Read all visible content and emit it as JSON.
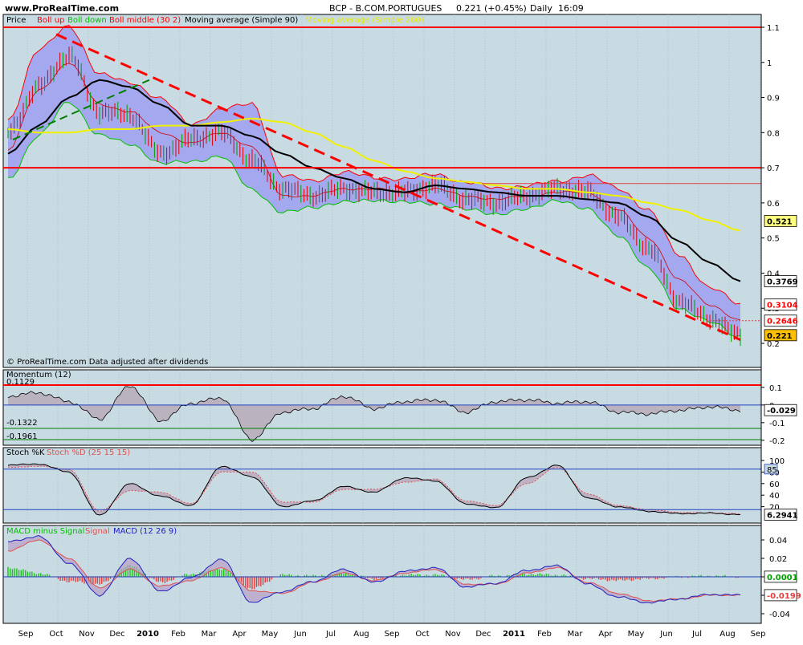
{
  "site": "www.ProRealTime.com",
  "header": {
    "ticker": "BCP - B.COM.PORTUGUES",
    "price": "0.221 (+0.45%)",
    "timeframe": "Daily",
    "time": "16:09"
  },
  "footer_note": "© ProRealTime.com  Data adjusted after dividends",
  "colors": {
    "panel_bg": "#c8dae2",
    "grid": "#9fb7c4",
    "boll_up": "#ff0000",
    "boll_down": "#00c000",
    "boll_middle": "#d00000",
    "band_fill": "#a3a8ef",
    "ma90": "#000000",
    "ma200": "#f0f000",
    "hline_red": "#ff0000",
    "candle_up": "#00a000",
    "candle_down": "#e00000"
  },
  "panels": {
    "price": {
      "legend": [
        {
          "text": "Price",
          "color": "#000000"
        },
        {
          "text": "Boll up",
          "color": "#ff0000"
        },
        {
          "text": "Boll down",
          "color": "#00c000"
        },
        {
          "text": "Boll middle (30 2)",
          "color": "#ff0000"
        },
        {
          "text": "Moving average (Simple 90)",
          "color": "#000000"
        },
        {
          "text": "Moving average (Simple 200)",
          "color": "#e8e800"
        }
      ],
      "ticks": [
        "1.1",
        "1",
        "0.9",
        "0.8",
        "0.7",
        "0.6",
        "0.5",
        "0.4",
        "0.3",
        "0.2"
      ],
      "tags": [
        {
          "text": "0.521",
          "bg": "#ffff80",
          "fg": "#000000"
        },
        {
          "text": "0.3769",
          "bg": "#ffffff",
          "fg": "#000000"
        },
        {
          "text": "0.3104",
          "bg": "#ffffff",
          "fg": "#ff0000"
        },
        {
          "text": "0.2646",
          "bg": "#ffffff",
          "fg": "#ff0000"
        },
        {
          "text": "0.221",
          "bg": "#ffc000",
          "fg": "#000000"
        }
      ]
    },
    "momentum": {
      "legend": "Momentum (12)",
      "labels": [
        "0.1129",
        "-0.1322",
        "-0.1961"
      ],
      "ticks": [
        "0.1",
        "0",
        "-0.1",
        "-0.2"
      ],
      "tag": "-0.029"
    },
    "stoch": {
      "legend_k": "Stoch %K",
      "legend_d": "Stoch %D (25 15 15)",
      "ticks": [
        "100",
        "80",
        "60",
        "40",
        "20"
      ],
      "tag_upper": "85",
      "tag_value": "6.2941"
    },
    "macd": {
      "legend_hist": "MACD minus Signal",
      "legend_signal": "Signal",
      "legend_macd": "MACD (12 26 9)",
      "ticks": [
        "0.04",
        "0.02",
        "0",
        "-0.02",
        "-0.04"
      ],
      "tag_hist": "0.0001",
      "tag_macd": "-0.0199"
    }
  },
  "xaxis": [
    "Sep",
    "Oct",
    "Nov",
    "Dec",
    "2010",
    "Feb",
    "Mar",
    "Apr",
    "May",
    "Jun",
    "Jul",
    "Aug",
    "Sep",
    "Oct",
    "Nov",
    "Dec",
    "2011",
    "Feb",
    "Mar",
    "Apr",
    "May",
    "Jun",
    "Jul",
    "Aug",
    "Sep"
  ],
  "chart_data": [
    {
      "type": "line",
      "title": "BCP - B.COM.PORTUGUES",
      "x": [
        "Sep",
        "Oct",
        "Nov",
        "Dec",
        "2010",
        "Feb",
        "Mar",
        "Apr",
        "May",
        "Jun",
        "Jul",
        "Aug",
        "Sep",
        "Oct",
        "Nov",
        "Dec",
        "2011",
        "Feb",
        "Mar",
        "Apr",
        "May",
        "Jun",
        "Jul",
        "Aug",
        "Sep"
      ],
      "ylim": [
        0.19,
        1.12
      ],
      "grid": false,
      "series": [
        {
          "name": "Price",
          "values": [
            0.8,
            0.93,
            1.02,
            0.86,
            0.85,
            0.74,
            0.78,
            0.8,
            0.72,
            0.64,
            0.62,
            0.64,
            0.63,
            0.63,
            0.65,
            0.61,
            0.6,
            0.62,
            0.64,
            0.63,
            0.56,
            0.47,
            0.32,
            0.27,
            0.221
          ]
        },
        {
          "name": "Boll up",
          "values": [
            0.83,
            1.04,
            1.1,
            0.97,
            0.94,
            0.9,
            0.82,
            0.87,
            0.88,
            0.68,
            0.66,
            0.69,
            0.67,
            0.67,
            0.68,
            0.66,
            0.64,
            0.65,
            0.66,
            0.68,
            0.64,
            0.58,
            0.45,
            0.36,
            0.31
          ]
        },
        {
          "name": "Boll down",
          "values": [
            0.67,
            0.79,
            0.89,
            0.79,
            0.77,
            0.71,
            0.72,
            0.73,
            0.64,
            0.57,
            0.59,
            0.6,
            0.61,
            0.6,
            0.6,
            0.58,
            0.57,
            0.58,
            0.61,
            0.58,
            0.51,
            0.41,
            0.3,
            0.26,
            0.22
          ]
        },
        {
          "name": "Boll middle",
          "values": [
            0.75,
            0.92,
            1.0,
            0.88,
            0.86,
            0.8,
            0.77,
            0.8,
            0.76,
            0.62,
            0.62,
            0.64,
            0.64,
            0.63,
            0.64,
            0.62,
            0.61,
            0.62,
            0.63,
            0.63,
            0.58,
            0.5,
            0.38,
            0.31,
            0.2646
          ]
        },
        {
          "name": "Moving average (Simple 90)",
          "values": [
            0.74,
            0.82,
            0.9,
            0.95,
            0.93,
            0.88,
            0.82,
            0.82,
            0.79,
            0.74,
            0.7,
            0.67,
            0.64,
            0.63,
            0.65,
            0.64,
            0.63,
            0.62,
            0.62,
            0.61,
            0.6,
            0.56,
            0.49,
            0.43,
            0.3769
          ]
        },
        {
          "name": "Moving average (Simple 200)",
          "values": [
            0.81,
            0.8,
            0.8,
            0.81,
            0.81,
            0.82,
            0.82,
            0.83,
            0.84,
            0.83,
            0.8,
            0.76,
            0.72,
            0.69,
            0.67,
            0.66,
            0.65,
            0.64,
            0.64,
            0.63,
            0.62,
            0.6,
            0.58,
            0.55,
            0.521
          ]
        }
      ],
      "horizontal_lines": [
        1.1,
        0.7
      ],
      "trendlines": [
        {
          "from": [
            "Nov",
            1.08
          ],
          "to": [
            "Sep",
            0.21
          ],
          "style": "dashed",
          "color": "#ff0000"
        },
        {
          "from": [
            "Sep",
            0.78
          ],
          "to": [
            "Feb",
            0.95
          ],
          "style": "dashed",
          "color": "#008000"
        }
      ]
    },
    {
      "type": "area",
      "title": "Momentum (12)",
      "x": [
        "Sep",
        "Oct",
        "Nov",
        "Dec",
        "2010",
        "Feb",
        "Mar",
        "Apr",
        "May",
        "Jun",
        "Jul",
        "Aug",
        "Sep",
        "Oct",
        "Nov",
        "Dec",
        "2011",
        "Feb",
        "Mar",
        "Apr",
        "May",
        "Jun",
        "Jul",
        "Aug",
        "Sep"
      ],
      "ylim": [
        -0.22,
        0.14
      ],
      "series": [
        {
          "name": "Momentum (12)",
          "values": [
            0.05,
            0.07,
            0.02,
            -0.08,
            0.11,
            -0.09,
            0.01,
            0.04,
            -0.196,
            -0.04,
            -0.02,
            0.05,
            -0.02,
            0.02,
            0.03,
            -0.04,
            0.02,
            0.03,
            0.01,
            0.02,
            -0.04,
            -0.05,
            -0.03,
            -0.01,
            -0.029
          ]
        }
      ],
      "horizontal_lines": [
        0.1129,
        -0.1322,
        -0.1961
      ]
    },
    {
      "type": "line",
      "title": "Stoch %K / Stoch %D (25 15 15)",
      "x": [
        "Sep",
        "Oct",
        "Nov",
        "Dec",
        "2010",
        "Feb",
        "Mar",
        "Apr",
        "May",
        "Jun",
        "Jul",
        "Aug",
        "Sep",
        "Oct",
        "Nov",
        "Dec",
        "2011",
        "Feb",
        "Mar",
        "Apr",
        "May",
        "Jun",
        "Jul",
        "Aug",
        "Sep"
      ],
      "ylim": [
        0,
        100
      ],
      "series": [
        {
          "name": "Stoch %K",
          "values": [
            92,
            94,
            80,
            5,
            60,
            38,
            22,
            90,
            72,
            20,
            30,
            55,
            45,
            70,
            65,
            25,
            18,
            70,
            92,
            35,
            20,
            12,
            8,
            9,
            6.2941
          ]
        },
        {
          "name": "Stoch %D",
          "values": [
            88,
            90,
            85,
            12,
            48,
            45,
            25,
            80,
            80,
            28,
            28,
            50,
            50,
            62,
            68,
            30,
            22,
            60,
            88,
            42,
            22,
            15,
            10,
            9,
            8
          ]
        }
      ],
      "horizontal_lines": [
        85,
        15
      ]
    },
    {
      "type": "line",
      "title": "MACD (12 26 9)",
      "x": [
        "Sep",
        "Oct",
        "Nov",
        "Dec",
        "2010",
        "Feb",
        "Mar",
        "Apr",
        "May",
        "Jun",
        "Jul",
        "Aug",
        "Sep",
        "Oct",
        "Nov",
        "Dec",
        "2011",
        "Feb",
        "Mar",
        "Apr",
        "May",
        "Jun",
        "Jul",
        "Aug",
        "Sep"
      ],
      "ylim": [
        -0.05,
        0.05
      ],
      "series": [
        {
          "name": "MACD minus Signal",
          "values": [
            0.01,
            0.004,
            -0.005,
            -0.008,
            0.012,
            -0.006,
            0.003,
            0.009,
            -0.013,
            0.002,
            0.001,
            0.004,
            -0.002,
            0.002,
            0.002,
            -0.003,
            0.001,
            0.003,
            0.002,
            -0.002,
            -0.004,
            -0.002,
            0.0,
            0.001,
            0.0001
          ]
        },
        {
          "name": "Signal",
          "values": [
            0.028,
            0.04,
            0.02,
            -0.012,
            0.008,
            -0.01,
            -0.004,
            0.01,
            -0.015,
            -0.018,
            -0.006,
            0.004,
            -0.004,
            0.004,
            0.008,
            -0.008,
            -0.008,
            0.004,
            0.01,
            -0.006,
            -0.018,
            -0.026,
            -0.024,
            -0.02,
            -0.0198
          ]
        },
        {
          "name": "MACD",
          "values": [
            0.038,
            0.044,
            0.015,
            -0.02,
            0.02,
            -0.016,
            -0.001,
            0.019,
            -0.028,
            -0.016,
            -0.005,
            0.008,
            -0.006,
            0.006,
            0.01,
            -0.011,
            -0.007,
            0.007,
            0.012,
            -0.008,
            -0.022,
            -0.028,
            -0.024,
            -0.019,
            -0.0199
          ]
        }
      ],
      "horizontal_lines": [
        0
      ]
    }
  ]
}
